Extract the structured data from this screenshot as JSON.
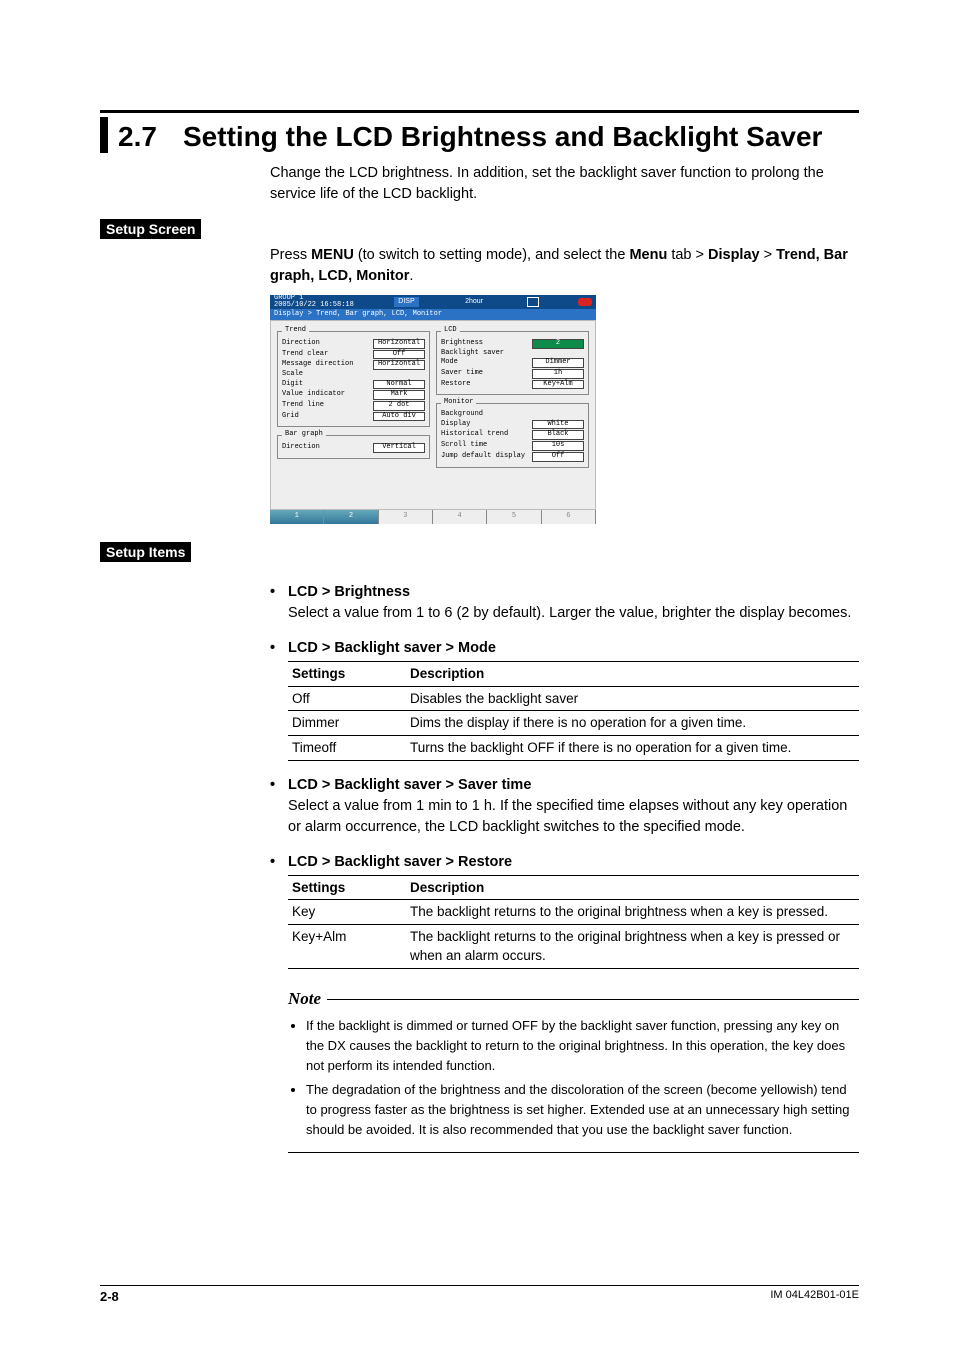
{
  "section_number": "2.7",
  "section_title": "Setting the LCD Brightness and Backlight Saver",
  "intro": "Change the LCD brightness. In addition, set the backlight saver function to prolong the service life of the LCD backlight.",
  "setup_screen_label": "Setup Screen",
  "setup_items_label": "Setup Items",
  "setup_screen_text_pre": "Press ",
  "menu_word": "MENU",
  "setup_screen_text_mid": " (to switch to setting mode), and select the ",
  "menu_tab": "Menu",
  "gt1": " tab > ",
  "display_word": "Display",
  "gt2": " > ",
  "trend_bar_lcd": "Trend, Bar graph, LCD, Monitor",
  "period": ".",
  "screenshot": {
    "group": "GROUP 1",
    "timestamp": "2005/10/22 16:58:18",
    "disp_chip": "DISP",
    "hour_chip": "2hour",
    "path": "Display > Trend, Bar graph, LCD, Monitor",
    "trend_legend": "Trend",
    "trend_rows": [
      {
        "label": "Direction",
        "val": "Horizontal"
      },
      {
        "label": "Trend clear",
        "val": "Off"
      },
      {
        "label": "Message direction",
        "val": "Horizontal"
      },
      {
        "label": "Scale",
        "val": ""
      },
      {
        "label": " Digit",
        "val": "Normal"
      },
      {
        "label": " Value indicator",
        "val": "Mark"
      },
      {
        "label": "Trend line",
        "val": "2  dot"
      },
      {
        "label": "Grid",
        "val": "Auto div"
      }
    ],
    "bar_legend": "Bar graph",
    "bar_rows": [
      {
        "label": "Direction",
        "val": "Vertical"
      }
    ],
    "lcd_legend": "LCD",
    "lcd_rows": [
      {
        "label": "Brightness",
        "val": "2",
        "hl": true
      },
      {
        "label": "Backlight saver",
        "val": ""
      },
      {
        "label": " Mode",
        "val": "Dimmer"
      },
      {
        "label": " Saver time",
        "val": "1h"
      },
      {
        "label": " Restore",
        "val": "Key+Alm"
      }
    ],
    "monitor_legend": "Monitor",
    "monitor_rows": [
      {
        "label": "Background",
        "val": ""
      },
      {
        "label": " Display",
        "val": "White"
      },
      {
        "label": " Historical trend",
        "val": "Black"
      },
      {
        "label": "Scroll time",
        "val": "10s"
      },
      {
        "label": "Jump default display",
        "val": "Off"
      }
    ],
    "fkeys": [
      "1",
      "2",
      "3",
      "4",
      "5",
      "6"
    ]
  },
  "item_brightness_title": "LCD > Brightness",
  "item_brightness_body": "Select a value from 1 to 6 (2 by default). Larger the value, brighter the display becomes.",
  "item_mode_title": "LCD > Backlight saver > Mode",
  "mode_table_headers": {
    "c1": "Settings",
    "c2": "Description"
  },
  "mode_table_rows": [
    {
      "c1": "Off",
      "c2": "Disables the backlight saver"
    },
    {
      "c1": "Dimmer",
      "c2": "Dims the display if there is no operation for a given time."
    },
    {
      "c1": "Timeoff",
      "c2": "Turns the backlight OFF if there is no operation for a given time."
    }
  ],
  "item_savertime_title": "LCD > Backlight saver > Saver time",
  "item_savertime_body": "Select a value from 1 min to 1 h. If the specified time elapses without any key operation or alarm occurrence, the LCD backlight switches to the specified mode.",
  "item_restore_title": "LCD > Backlight saver > Restore",
  "restore_table_headers": {
    "c1": "Settings",
    "c2": "Description"
  },
  "restore_table_rows": [
    {
      "c1": "Key",
      "c2": "The backlight returns to the original brightness when a key is pressed."
    },
    {
      "c1": "Key+Alm",
      "c2": "The backlight returns to the original brightness when a key is pressed or when an alarm occurs."
    }
  ],
  "note_word": "Note",
  "note_items": [
    "If the backlight is dimmed or turned OFF by the backlight saver function, pressing any key on the DX causes the backlight to return to the original brightness. In this operation, the key does not perform its intended function.",
    "The degradation of the brightness and the discoloration of the screen (become yellowish) tend to progress faster as the brightness is set higher. Extended use at an unnecessary high setting should be avoided. It is also recommended that you use the backlight saver function."
  ],
  "footer_page": "2-8",
  "footer_doc": "IM 04L42B01-01E"
}
